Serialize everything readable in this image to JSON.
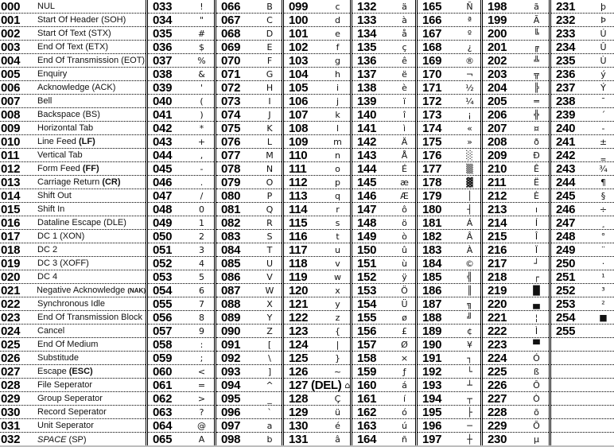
{
  "control": [
    {
      "code": "000",
      "name": "NUL"
    },
    {
      "code": "001",
      "name": "Start Of Header (SOH)"
    },
    {
      "code": "002",
      "name": "Start Of Text (STX)"
    },
    {
      "code": "003",
      "name": "End   Of Text (ETX)"
    },
    {
      "code": "004",
      "name": "End Of Transmission (EOT)"
    },
    {
      "code": "005",
      "name": "Enquiry"
    },
    {
      "code": "006",
      "name": "Acknowledge (ACK)"
    },
    {
      "code": "007",
      "name": "Bell"
    },
    {
      "code": "008",
      "name": "Backspace (BS)"
    },
    {
      "code": "009",
      "name": "Horizontal Tab"
    },
    {
      "code": "010",
      "name": "Line Feed ",
      "bold": "(LF)"
    },
    {
      "code": "011",
      "name": "Vertical Tab"
    },
    {
      "code": "012",
      "name": "Form Feed ",
      "bold": "(FF)"
    },
    {
      "code": "013",
      "name": "Carriage Return ",
      "bold": "(CR)"
    },
    {
      "code": "014",
      "name": "Shift Out"
    },
    {
      "code": "015",
      "name": "Shift In"
    },
    {
      "code": "016",
      "name": "Dataline Escape (DLE)"
    },
    {
      "code": "017",
      "name": "DC 1 (XON)"
    },
    {
      "code": "018",
      "name": "DC 2"
    },
    {
      "code": "019",
      "name": "DC 3 (XOFF)"
    },
    {
      "code": "020",
      "name": "DC 4"
    },
    {
      "code": "021",
      "name": "Negative Acknowledge ",
      "small": "(NAK)"
    },
    {
      "code": "022",
      "name": "Synchronous Idle"
    },
    {
      "code": "023",
      "name": "End Of Transmission Block"
    },
    {
      "code": "024",
      "name": "Cancel"
    },
    {
      "code": "025",
      "name": "End Of Medium"
    },
    {
      "code": "026",
      "name": "Substitude"
    },
    {
      "code": "027",
      "name": "Escape ",
      "bold": "(ESC)"
    },
    {
      "code": "028",
      "name": "File Seperator"
    },
    {
      "code": "029",
      "name": "Group Seperator"
    },
    {
      "code": "030",
      "name": "Record Seperator"
    },
    {
      "code": "031",
      "name": "Unit Seperator"
    },
    {
      "code": "032",
      "italic": "SPACE",
      "name": " (SP)"
    }
  ],
  "columns": [
    [
      [
        "033",
        "!"
      ],
      [
        "034",
        "\""
      ],
      [
        "035",
        "#"
      ],
      [
        "036",
        "$"
      ],
      [
        "037",
        "%"
      ],
      [
        "038",
        "&"
      ],
      [
        "039",
        "'"
      ],
      [
        "040",
        "("
      ],
      [
        "041",
        ")"
      ],
      [
        "042",
        "*"
      ],
      [
        "043",
        "+"
      ],
      [
        "044",
        ","
      ],
      [
        "045",
        "-"
      ],
      [
        "046",
        "."
      ],
      [
        "047",
        "/"
      ],
      [
        "048",
        "0"
      ],
      [
        "049",
        "1"
      ],
      [
        "050",
        "2"
      ],
      [
        "051",
        "3"
      ],
      [
        "052",
        "4"
      ],
      [
        "053",
        "5"
      ],
      [
        "054",
        "6"
      ],
      [
        "055",
        "7"
      ],
      [
        "056",
        "8"
      ],
      [
        "057",
        "9"
      ],
      [
        "058",
        ":"
      ],
      [
        "059",
        ";"
      ],
      [
        "060",
        "<"
      ],
      [
        "061",
        "="
      ],
      [
        "062",
        ">"
      ],
      [
        "063",
        "?"
      ],
      [
        "064",
        "@"
      ],
      [
        "065",
        "A"
      ]
    ],
    [
      [
        "066",
        "B"
      ],
      [
        "067",
        "C"
      ],
      [
        "068",
        "D"
      ],
      [
        "069",
        "E"
      ],
      [
        "070",
        "F"
      ],
      [
        "071",
        "G"
      ],
      [
        "072",
        "H"
      ],
      [
        "073",
        "I"
      ],
      [
        "074",
        "J"
      ],
      [
        "075",
        "K"
      ],
      [
        "076",
        "L"
      ],
      [
        "077",
        "M"
      ],
      [
        "078",
        "N"
      ],
      [
        "079",
        "O"
      ],
      [
        "080",
        "P"
      ],
      [
        "081",
        "Q"
      ],
      [
        "082",
        "R"
      ],
      [
        "083",
        "S"
      ],
      [
        "084",
        "T"
      ],
      [
        "085",
        "U"
      ],
      [
        "086",
        "V"
      ],
      [
        "087",
        "W"
      ],
      [
        "088",
        "X"
      ],
      [
        "089",
        "Y"
      ],
      [
        "090",
        "Z"
      ],
      [
        "091",
        "["
      ],
      [
        "092",
        "\\"
      ],
      [
        "093",
        "]"
      ],
      [
        "094",
        "^"
      ],
      [
        "095",
        "_"
      ],
      [
        "096",
        "`"
      ],
      [
        "097",
        "a"
      ],
      [
        "098",
        "b"
      ]
    ],
    [
      [
        "099",
        "c"
      ],
      [
        "100",
        "d"
      ],
      [
        "101",
        "e"
      ],
      [
        "102",
        "f"
      ],
      [
        "103",
        "g"
      ],
      [
        "104",
        "h"
      ],
      [
        "105",
        "i"
      ],
      [
        "106",
        "j"
      ],
      [
        "107",
        "k"
      ],
      [
        "108",
        "l"
      ],
      [
        "109",
        "m"
      ],
      [
        "110",
        "n"
      ],
      [
        "111",
        "o"
      ],
      [
        "112",
        "p"
      ],
      [
        "113",
        "q"
      ],
      [
        "114",
        "r"
      ],
      [
        "115",
        "s"
      ],
      [
        "116",
        "t"
      ],
      [
        "117",
        "u"
      ],
      [
        "118",
        "v"
      ],
      [
        "119",
        "w"
      ],
      [
        "120",
        "x"
      ],
      [
        "121",
        "y"
      ],
      [
        "122",
        "z"
      ],
      [
        "123",
        "{"
      ],
      [
        "124",
        "|"
      ],
      [
        "125",
        "}"
      ],
      [
        "126",
        "~"
      ],
      [
        "127 (DEL)",
        "⌂"
      ],
      [
        "128",
        "Ç"
      ],
      [
        "129",
        "ü"
      ],
      [
        "130",
        "é"
      ],
      [
        "131",
        "â"
      ]
    ],
    [
      [
        "132",
        "ä"
      ],
      [
        "133",
        "à"
      ],
      [
        "134",
        "å"
      ],
      [
        "135",
        "ç"
      ],
      [
        "136",
        "ê"
      ],
      [
        "137",
        "ë"
      ],
      [
        "138",
        "è"
      ],
      [
        "139",
        "ï"
      ],
      [
        "140",
        "î"
      ],
      [
        "141",
        "ì"
      ],
      [
        "142",
        "Ä"
      ],
      [
        "143",
        "Å"
      ],
      [
        "144",
        "É"
      ],
      [
        "145",
        "æ"
      ],
      [
        "146",
        "Æ"
      ],
      [
        "147",
        "ô"
      ],
      [
        "148",
        "ö"
      ],
      [
        "149",
        "ò"
      ],
      [
        "150",
        "û"
      ],
      [
        "151",
        "ù"
      ],
      [
        "152",
        "ÿ"
      ],
      [
        "153",
        "Ö"
      ],
      [
        "154",
        "Ü"
      ],
      [
        "155",
        "ø"
      ],
      [
        "156",
        "£"
      ],
      [
        "157",
        "Ø"
      ],
      [
        "158",
        "×"
      ],
      [
        "159",
        "ƒ"
      ],
      [
        "160",
        "á"
      ],
      [
        "161",
        "í"
      ],
      [
        "162",
        "ó"
      ],
      [
        "163",
        "ú"
      ],
      [
        "164",
        "ñ"
      ]
    ],
    [
      [
        "165",
        "Ñ"
      ],
      [
        "166",
        "ª"
      ],
      [
        "167",
        "º"
      ],
      [
        "168",
        "¿"
      ],
      [
        "169",
        "®"
      ],
      [
        "170",
        "¬"
      ],
      [
        "171",
        "½"
      ],
      [
        "172",
        "¼"
      ],
      [
        "173",
        "¡"
      ],
      [
        "174",
        "«"
      ],
      [
        "175",
        "»"
      ],
      [
        "176",
        "░"
      ],
      [
        "177",
        "▒"
      ],
      [
        "178",
        "▓"
      ],
      [
        "179",
        "│"
      ],
      [
        "180",
        "┤"
      ],
      [
        "181",
        "Á"
      ],
      [
        "182",
        "Â"
      ],
      [
        "183",
        "À"
      ],
      [
        "184",
        "©"
      ],
      [
        "185",
        "╣"
      ],
      [
        "186",
        "║"
      ],
      [
        "187",
        "╗"
      ],
      [
        "188",
        "╝"
      ],
      [
        "189",
        "¢"
      ],
      [
        "190",
        "¥"
      ],
      [
        "191",
        "┐"
      ],
      [
        "192",
        "└"
      ],
      [
        "193",
        "┴"
      ],
      [
        "194",
        "┬"
      ],
      [
        "195",
        "├"
      ],
      [
        "196",
        "─"
      ],
      [
        "197",
        "┼"
      ]
    ],
    [
      [
        "198",
        "ã"
      ],
      [
        "199",
        "Ã"
      ],
      [
        "200",
        "╚"
      ],
      [
        "201",
        "╔"
      ],
      [
        "202",
        "╩"
      ],
      [
        "203",
        "╦"
      ],
      [
        "204",
        "╠"
      ],
      [
        "205",
        "═"
      ],
      [
        "206",
        "╬"
      ],
      [
        "207",
        "¤"
      ],
      [
        "208",
        "ð"
      ],
      [
        "209",
        "Ð"
      ],
      [
        "210",
        "Ê"
      ],
      [
        "211",
        "Ë"
      ],
      [
        "212",
        "È"
      ],
      [
        "213",
        "ı"
      ],
      [
        "214",
        "Í"
      ],
      [
        "215",
        "Î"
      ],
      [
        "216",
        "Ï"
      ],
      [
        "217",
        "┘"
      ],
      [
        "218",
        "┌"
      ],
      [
        "219",
        "█"
      ],
      [
        "220",
        "▄"
      ],
      [
        "221",
        "¦"
      ],
      [
        "222",
        "Ì"
      ],
      [
        "223",
        "▀"
      ],
      [
        "224",
        "Ó"
      ],
      [
        "225",
        "ß"
      ],
      [
        "226",
        "Ô"
      ],
      [
        "227",
        "Ò"
      ],
      [
        "228",
        "õ"
      ],
      [
        "229",
        "Õ"
      ],
      [
        "230",
        "µ"
      ]
    ],
    [
      [
        "231",
        "þ"
      ],
      [
        "232",
        "Þ"
      ],
      [
        "233",
        "Ú"
      ],
      [
        "234",
        "Û"
      ],
      [
        "235",
        "Ù"
      ],
      [
        "236",
        "ý"
      ],
      [
        "237",
        "Ý"
      ],
      [
        "238",
        "¯"
      ],
      [
        "239",
        "´"
      ],
      [
        "240",
        "-"
      ],
      [
        "241",
        "±"
      ],
      [
        "242",
        "‗"
      ],
      [
        "243",
        "¾"
      ],
      [
        "244",
        "¶"
      ],
      [
        "245",
        "§"
      ],
      [
        "246",
        "÷"
      ],
      [
        "247",
        "¸"
      ],
      [
        "248",
        "°"
      ],
      [
        "249",
        "¨"
      ],
      [
        "250",
        "·"
      ],
      [
        "251",
        "¹"
      ],
      [
        "252",
        "³"
      ],
      [
        "253",
        "²"
      ],
      [
        "254",
        "■"
      ],
      [
        "255",
        ""
      ],
      [
        "",
        ""
      ],
      [
        "",
        ""
      ],
      [
        "",
        ""
      ],
      [
        "",
        ""
      ],
      [
        "",
        ""
      ],
      [
        "",
        ""
      ],
      [
        "",
        ""
      ],
      [
        "",
        ""
      ]
    ]
  ]
}
